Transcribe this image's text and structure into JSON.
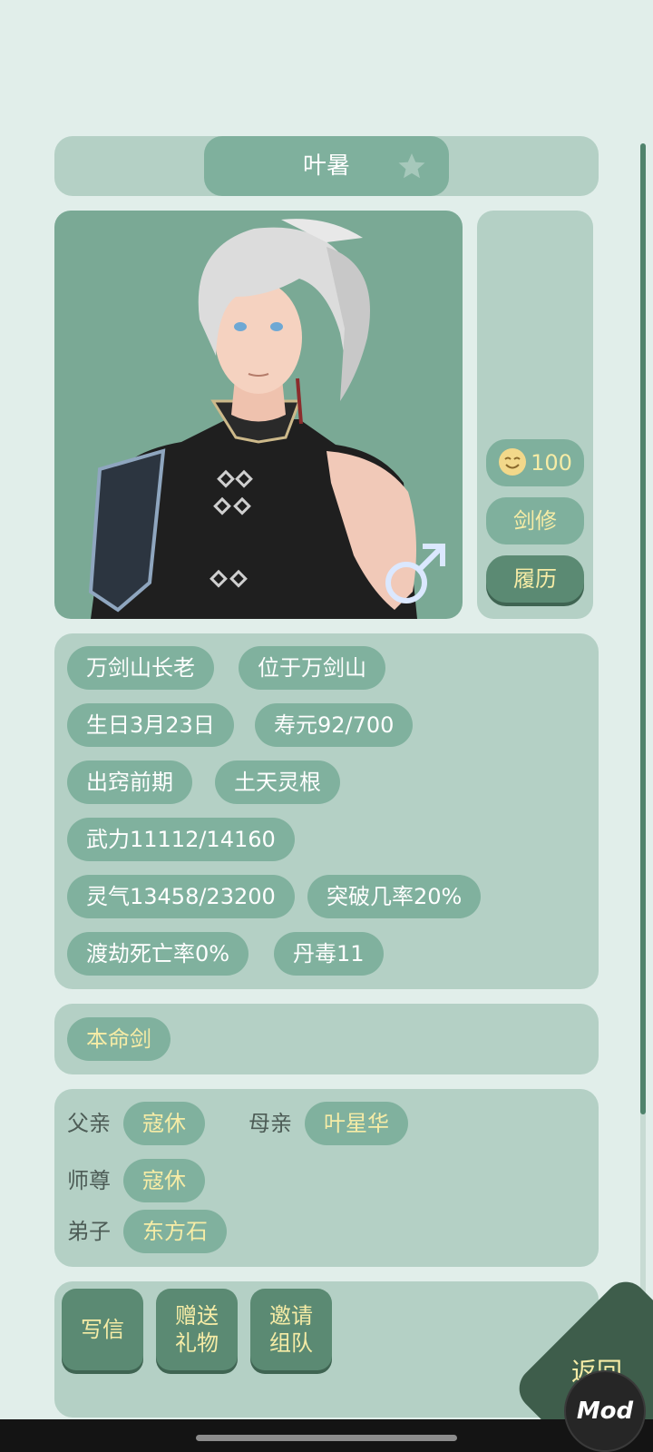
{
  "header": {
    "name": "叶暑",
    "favorite_icon": "star-icon"
  },
  "portrait": {
    "gender_icon": "male-symbol-icon",
    "gender_color": "#dbe8ff"
  },
  "side": {
    "mood_icon": "smiley-face-icon",
    "mood_value": "100",
    "class_label": "剑修",
    "history_label": "履历"
  },
  "info": {
    "title": "万剑山长老",
    "location": "位于万剑山",
    "birthday": "生日3月23日",
    "lifespan": "寿元92/700",
    "realm": "出窍前期",
    "spirit_root": "土天灵根",
    "power": "武力11112/14160",
    "qi": "灵气13458/23200",
    "breakthrough": "突破几率20%",
    "tribulation_death": "渡劫死亡率0%",
    "pill_poison": "丹毒11"
  },
  "sword": {
    "label": "本命剑"
  },
  "relations": {
    "father_label": "父亲",
    "father_name": "寇休",
    "mother_label": "母亲",
    "mother_name": "叶星华",
    "master_label": "师尊",
    "master_name": "寇休",
    "disciple_label": "弟子",
    "disciple_name": "东方石"
  },
  "actions": {
    "write_letter": "写信",
    "gift_line1": "赠送",
    "gift_line2": "礼物",
    "invite_line1": "邀请",
    "invite_line2": "组队"
  },
  "return_label": "返回",
  "mod_badge": "Mod",
  "colors": {
    "background": "#e1eeea",
    "panel": "#b4d0c5",
    "pill": "#80b19e",
    "dark_button": "#5b8a73",
    "accent_text": "#f6eca6"
  }
}
